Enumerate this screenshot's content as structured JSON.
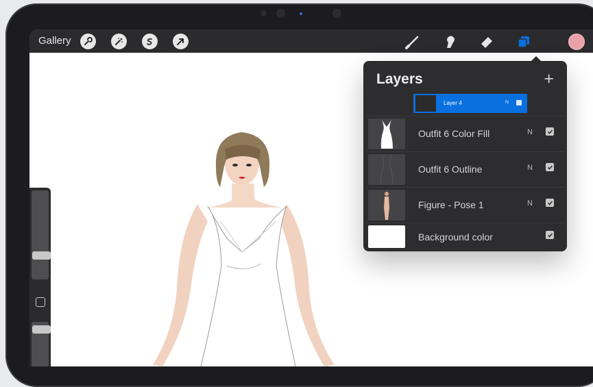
{
  "toolbar": {
    "gallery_label": "Gallery",
    "left_tools": [
      "wrench-icon",
      "magic-wand-icon",
      "selection-icon",
      "transform-arrow-icon"
    ],
    "right_tools": [
      "brush-icon",
      "smudge-icon",
      "eraser-icon",
      "layers-icon"
    ],
    "active_tool": "layers-icon",
    "accent_color": "#0a70e0",
    "current_color": "#e9a1a8"
  },
  "layers": {
    "title": "Layers",
    "add_symbol": "+",
    "dragging": {
      "name": "Layer 4",
      "mode": "N"
    },
    "items": [
      {
        "name": "Outfit 6 Color Fill",
        "mode": "N",
        "visible": true
      },
      {
        "name": "Outfit 6 Outline",
        "mode": "N",
        "visible": true
      },
      {
        "name": "Figure - Pose 1",
        "mode": "N",
        "visible": true
      },
      {
        "name": "Background color",
        "mode": "",
        "visible": true
      }
    ]
  }
}
